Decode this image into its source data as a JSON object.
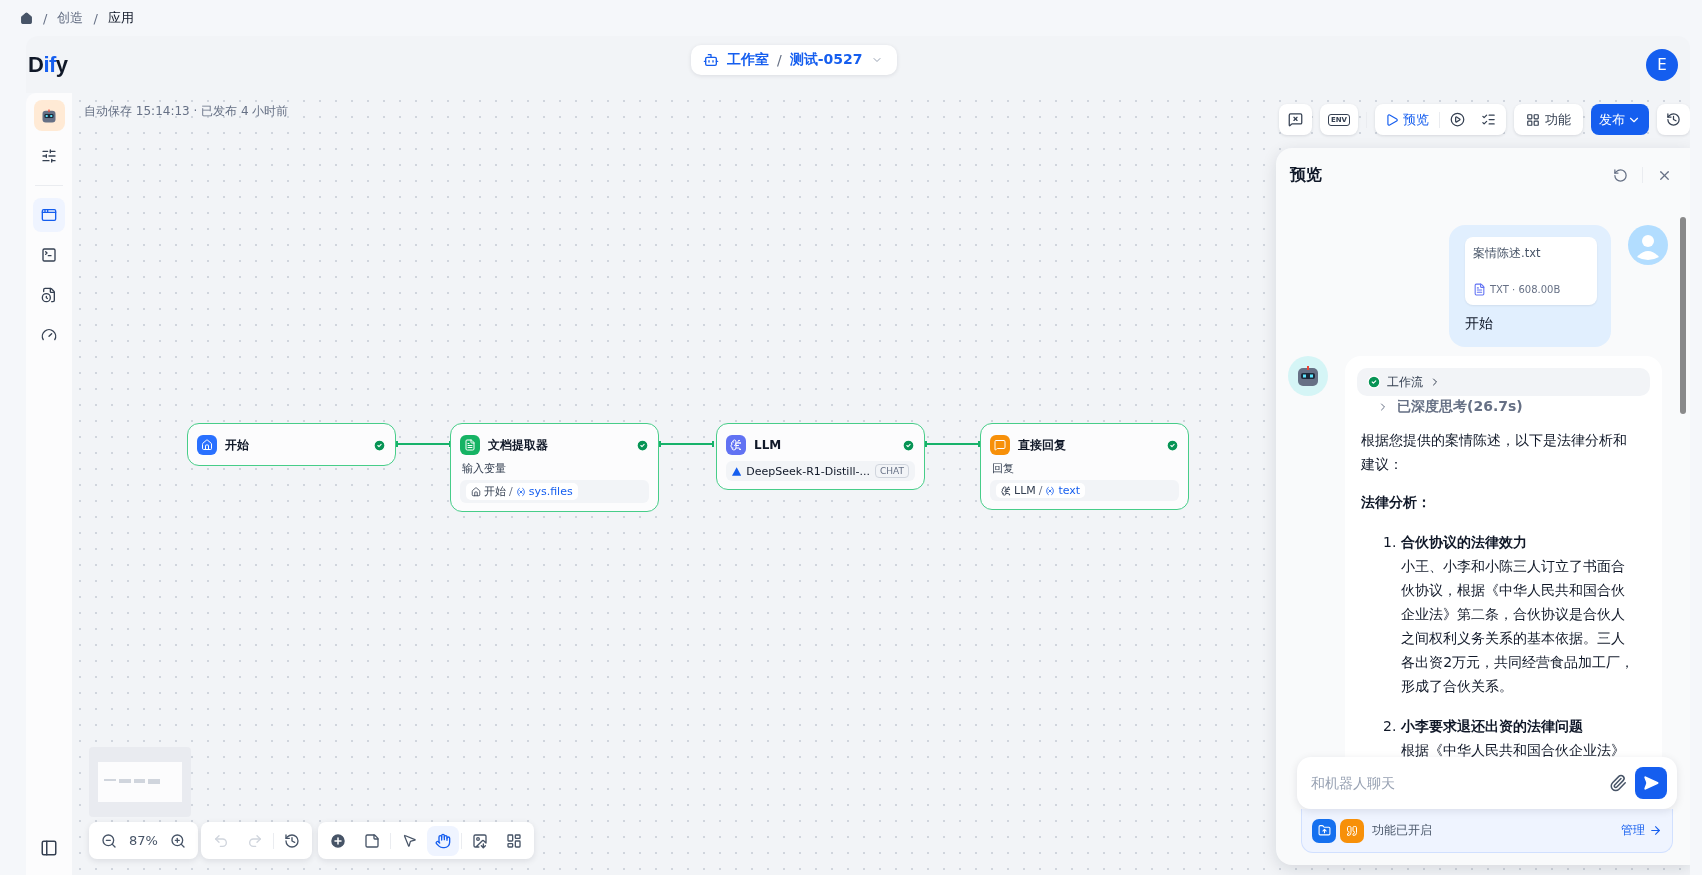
{
  "breadcrumb": [
    {
      "separator": "/",
      "label": "创造"
    },
    {
      "separator": "/",
      "label": "应用"
    }
  ],
  "header": {
    "logo": [
      {
        "text": "D",
        "accent": false
      },
      {
        "text": "if",
        "accent": true
      },
      {
        "text": "y",
        "accent": false
      }
    ],
    "workspace": "工作室",
    "separator": "/",
    "app": "测试-0527",
    "user_initial": "E"
  },
  "sidebar": {
    "items": [
      {
        "kind": "settings",
        "selected": false
      },
      {
        "kind": "workflow",
        "selected": true
      },
      {
        "kind": "terminal",
        "selected": false
      },
      {
        "kind": "logs",
        "selected": false
      },
      {
        "kind": "monitor",
        "selected": false
      }
    ]
  },
  "canvas": {
    "status": "自动保存 15:14:13 · 已发布 4 小时前",
    "toolbar": {
      "env_label": "ENV",
      "preview": "预览",
      "features": "功能",
      "publish": "发布"
    },
    "nodes": [
      {
        "kind": "start",
        "title": "开始",
        "succeeded": true
      },
      {
        "kind": "doc-extractor",
        "title": "文档提取器",
        "succeeded": true,
        "field_label": "输入变量",
        "var_source": "开始",
        "var_separator": "/",
        "var_name": "sys.files"
      },
      {
        "kind": "llm",
        "title": "LLM",
        "succeeded": true,
        "model": "DeepSeek-R1-Distill-...",
        "mode": "CHAT"
      },
      {
        "kind": "answer",
        "title": "直接回复",
        "succeeded": true,
        "field_label": "回复",
        "var_source": "LLM",
        "var_separator": "/",
        "var_name": "text"
      }
    ],
    "zoom": "87%",
    "history": [
      {
        "kind": "undo",
        "disabled": true
      },
      {
        "kind": "redo",
        "disabled": true
      }
    ],
    "tools": [
      {
        "kind": "pointer",
        "selected": false
      },
      {
        "kind": "hand",
        "selected": true
      }
    ]
  },
  "preview": {
    "title": "预览",
    "user_message": {
      "file_name": "案情陈述.txt",
      "file_meta": "TXT · 608.00B",
      "text": "开始"
    },
    "bot_message": {
      "workflow": "工作流",
      "workflow_succeeded": true,
      "thought": "已深度思考(26.7s)",
      "intro": "根据您提供的案情陈述，以下是法律分析和建议：",
      "heading": "法律分析：",
      "items": [
        {
          "number": "1.",
          "title": "合伙协议的法律效力",
          "body": "小王、小李和小陈三人订立了书面合伙协议，根据《中华人民共和国合伙企业法》第二条，合伙协议是合伙人之间权利义务关系的基本依据。三人各出资2万元，共同经营食品加工厂，形成了合伙关系。"
        },
        {
          "number": "2.",
          "title": "小李要求退还出资的法律问题",
          "body": "根据《中华人民共和国合伙企业法》"
        }
      ]
    },
    "input": {
      "placeholder": "和机器人聊天"
    },
    "features": {
      "label": "功能已开启",
      "manage": "管理"
    }
  }
}
